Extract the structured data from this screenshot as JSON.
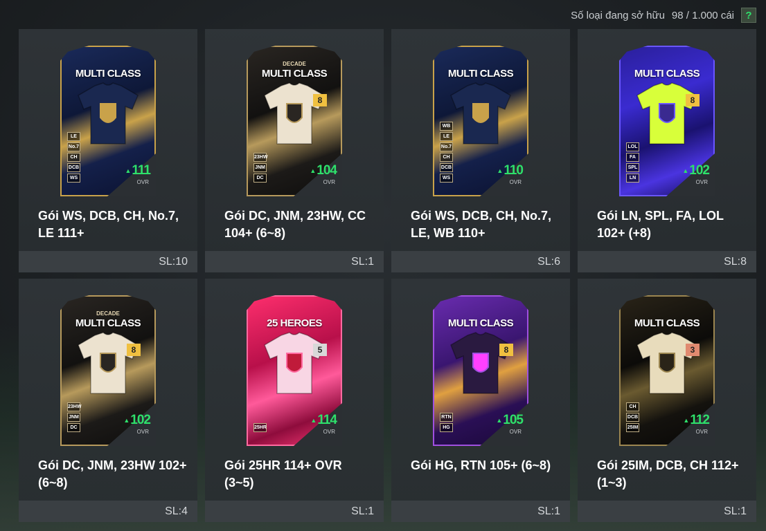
{
  "header": {
    "owned_label": "Số loại đang sở hữu",
    "owned_value": "98 / 1.000 cái",
    "help_label": "?"
  },
  "packs": [
    {
      "title": "Gói WS, DCB, CH, No.7, LE 111+",
      "qty": "SL:10",
      "card_name": "MULTI CLASS",
      "card_sub": "",
      "level": "",
      "ovr": "111",
      "ovr_label": "OVR",
      "positions": [
        "LE",
        "No.7",
        "CH",
        "DCB",
        "WS"
      ],
      "theme": "blue-gold"
    },
    {
      "title": "Gói DC, JNM, 23HW, CC 104+ (6~8)",
      "qty": "SL:1",
      "card_name": "MULTI CLASS",
      "card_sub": "DECADE",
      "level": "8",
      "ovr": "104",
      "ovr_label": "OVR",
      "positions": [
        "23HW",
        "JNM",
        "DC"
      ],
      "theme": "decade"
    },
    {
      "title": "Gói WS, DCB, CH, No.7, LE, WB 110+",
      "qty": "SL:6",
      "card_name": "MULTI CLASS",
      "card_sub": "",
      "level": "",
      "ovr": "110",
      "ovr_label": "OVR",
      "positions": [
        "WB",
        "LE",
        "No.7",
        "CH",
        "DCB",
        "WS"
      ],
      "theme": "blue-gold"
    },
    {
      "title": "Gói LN, SPL, FA, LOL 102+ (+8)",
      "qty": "SL:8",
      "card_name": "MULTI CLASS",
      "card_sub": "",
      "level": "8",
      "ovr": "102",
      "ovr_label": "OVR",
      "positions": [
        "LOL",
        "FA",
        "SPL",
        "LN"
      ],
      "theme": "purple-neon"
    },
    {
      "title": "Gói DC, JNM, 23HW 102+ (6~8)",
      "qty": "SL:4",
      "card_name": "MULTI CLASS",
      "card_sub": "DECADE",
      "level": "8",
      "ovr": "102",
      "ovr_label": "OVR",
      "positions": [
        "23HW",
        "JNM",
        "DC"
      ],
      "theme": "decade"
    },
    {
      "title": "Gói 25HR 114+ OVR (3~5)",
      "qty": "SL:1",
      "card_name": "25 HEROES",
      "card_sub": "",
      "level": "5",
      "ovr": "114",
      "ovr_label": "OVR",
      "positions": [
        "25HR"
      ],
      "theme": "heroes"
    },
    {
      "title": "Gói HG, RTN 105+ (6~8)",
      "qty": "SL:1",
      "card_name": "MULTI CLASS",
      "card_sub": "",
      "level": "8",
      "ovr": "105",
      "ovr_label": "OVR",
      "positions": [
        "RTN",
        "HG"
      ],
      "theme": "violet-gold"
    },
    {
      "title": "Gói 25IM, DCB, CH 112+ (1~3)",
      "qty": "SL:1",
      "card_name": "MULTI CLASS",
      "card_sub": "",
      "level": "3",
      "ovr": "112",
      "ovr_label": "OVR",
      "positions": [
        "CH",
        "DCB",
        "25IM"
      ],
      "theme": "black-gold"
    }
  ]
}
